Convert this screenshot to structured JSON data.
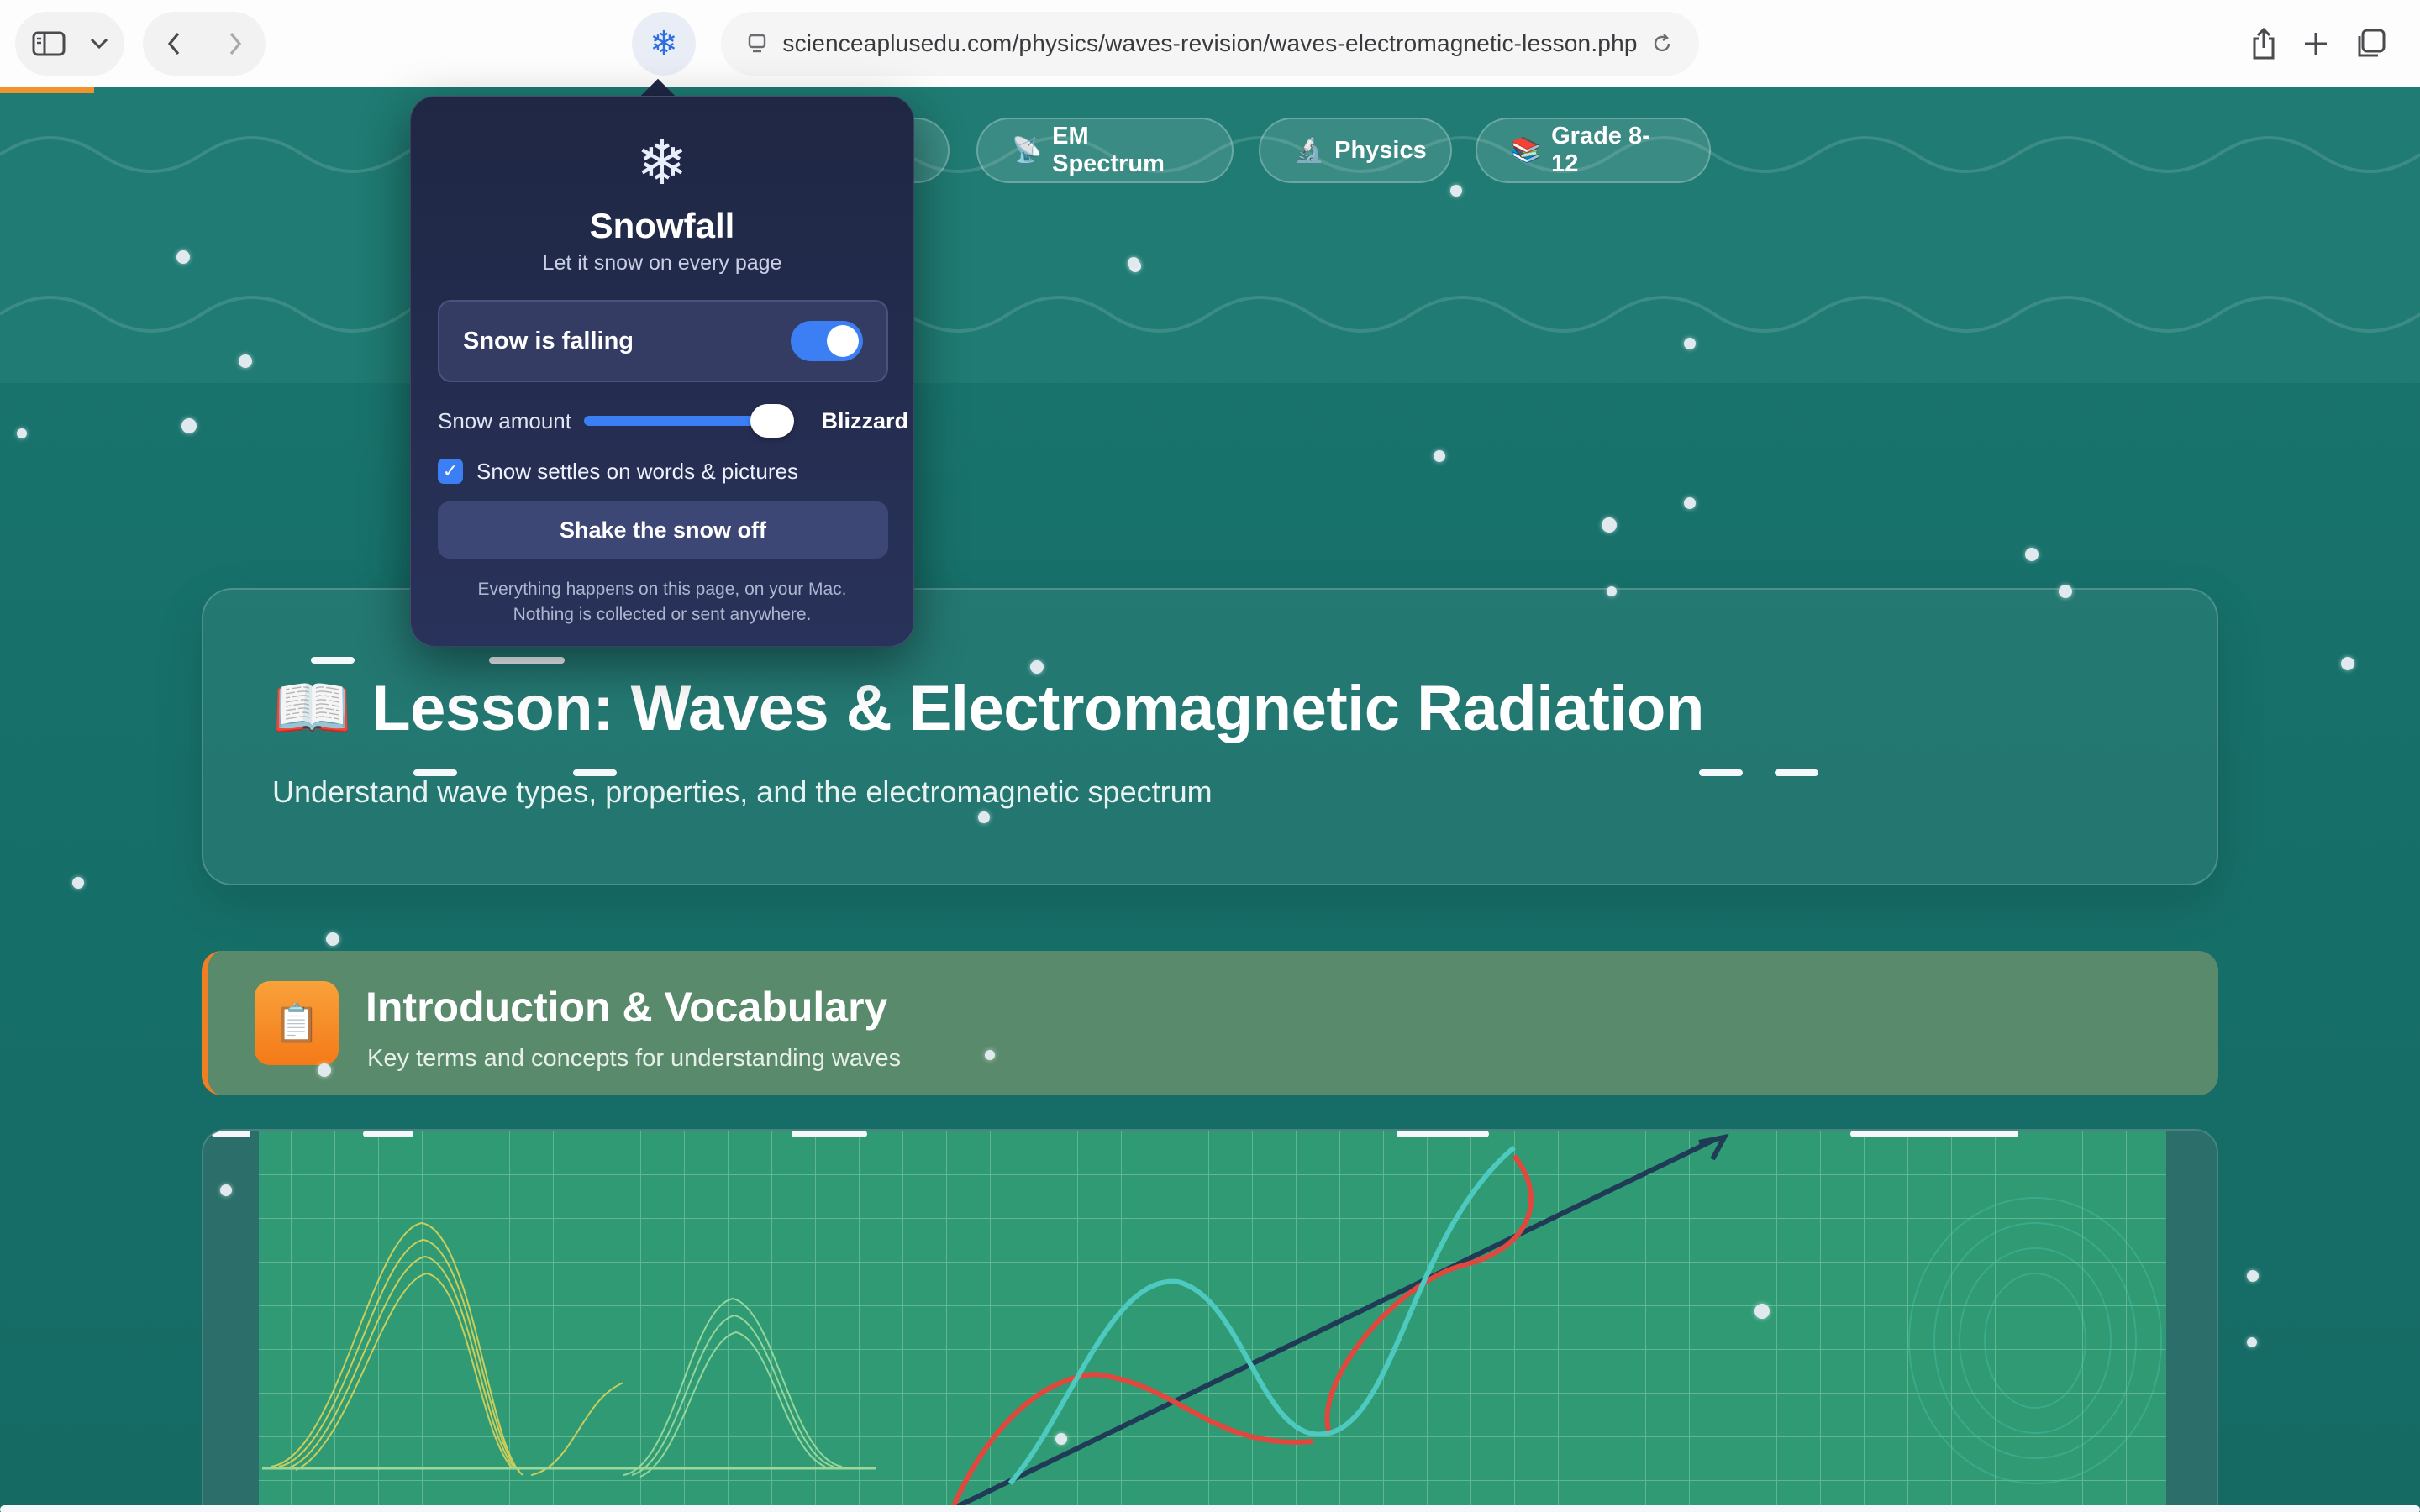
{
  "browser": {
    "url": "scienceaplusedu.com/physics/waves-revision/waves-electromagnetic-lesson.php"
  },
  "tags": [
    {
      "icon": "📡",
      "label": "EM Spectrum"
    },
    {
      "icon": "🔬",
      "label": "Physics"
    },
    {
      "icon": "📚",
      "label": "Grade 8-12"
    }
  ],
  "hero": {
    "icon": "📖",
    "title": "Lesson: Waves & Electromagnetic Radiation",
    "subtitle": "Understand wave types, properties, and the electromagnetic spectrum"
  },
  "section": {
    "icon": "📋",
    "title": "Introduction & Vocabulary",
    "subtitle": "Key terms and concepts for understanding waves"
  },
  "popover": {
    "icon": "❄",
    "title": "Snowfall",
    "subtitle": "Let it snow on every page",
    "toggle_label": "Snow is falling",
    "toggle_on": true,
    "amount_label": "Snow amount",
    "amount_value": "Blizzard",
    "amount_level": 1.0,
    "settle_label": "Snow settles on words & pictures",
    "settle_checked": true,
    "shake_button": "Shake the snow off",
    "privacy_line1": "Everything happens on this page, on your Mac.",
    "privacy_line2": "Nothing is collected or sent anywhere."
  },
  "colors": {
    "page_bg": "#177069",
    "accent_orange": "#f07e24",
    "toggle_blue": "#3c7ef3",
    "popover_bg": "#1f2744"
  }
}
